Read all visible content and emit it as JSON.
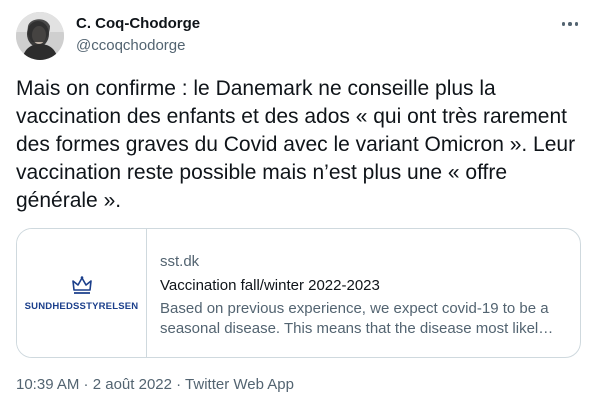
{
  "author": {
    "display_name": "C. Coq-Chodorge",
    "handle": "@ccoqchodorge"
  },
  "tweet": {
    "text": "Mais on confirme : le Danemark ne conseille plus la vaccination des enfants et des ados « qui ont très rarement des formes graves du Covid avec le variant Omicron ». Leur vaccination reste possible mais n’est plus une « offre générale »."
  },
  "card": {
    "logo_text": "SUNDHEDSSTYRELSEN",
    "domain": "sst.dk",
    "title": "Vaccination fall/winter 2022-2023",
    "description": "Based on previous experience, we expect covid-19 to be a seasonal disease. This means that the disease most likely appears in the autumn and winter."
  },
  "meta": {
    "time": "10:39 AM",
    "separator1": " · ",
    "date": "2 août 2022",
    "separator2": " · ",
    "source": "Twitter Web App"
  },
  "colors": {
    "text": "#0f1419",
    "secondary": "#536471",
    "border": "#cfd9de",
    "logo": "#1b3f8b"
  },
  "icons": {
    "more": "more-icon",
    "crown": "crown-icon"
  }
}
